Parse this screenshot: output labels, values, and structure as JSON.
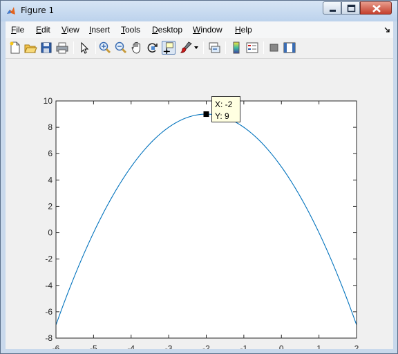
{
  "window": {
    "title": "Figure 1"
  },
  "menu": [
    {
      "label": "File",
      "u": "F",
      "rest": "ile"
    },
    {
      "label": "Edit",
      "u": "E",
      "rest": "dit"
    },
    {
      "label": "View",
      "u": "V",
      "rest": "iew"
    },
    {
      "label": "Insert",
      "u": "I",
      "rest": "nsert"
    },
    {
      "label": "Tools",
      "u": "T",
      "rest": "ools"
    },
    {
      "label": "Desktop",
      "u": "D",
      "rest": "esktop"
    },
    {
      "label": "Window",
      "u": "W",
      "rest": "indow"
    },
    {
      "label": "Help",
      "u": "H",
      "rest": "elp"
    }
  ],
  "toolbar": {
    "icons": [
      "new-figure-icon",
      "open-file-icon",
      "save-icon",
      "print-icon",
      "edit-plot-arrow-icon",
      "zoom-in-icon",
      "zoom-out-icon",
      "pan-hand-icon",
      "rotate-3d-icon",
      "data-cursor-icon",
      "brush-icon",
      "link-plot-icon",
      "insert-colorbar-icon",
      "insert-legend-icon",
      "hide-plot-tools-icon",
      "show-plot-tools-icon"
    ],
    "active": "data-cursor-icon"
  },
  "datatip": {
    "x_text": "X: -2",
    "y_text": "Y: 9"
  },
  "chart_data": {
    "type": "line",
    "title": "",
    "xlabel": "",
    "ylabel": "",
    "xlim": [
      -6,
      2
    ],
    "ylim": [
      -8,
      10
    ],
    "x_ticks": [
      -6,
      -5,
      -4,
      -3,
      -2,
      -1,
      0,
      1,
      2
    ],
    "y_ticks": [
      -8,
      -6,
      -4,
      -2,
      0,
      2,
      4,
      6,
      8,
      10
    ],
    "series": [
      {
        "function": "y = -(x + 2)^2 + 9",
        "x": [
          -6,
          -5,
          -4,
          -3,
          -2,
          -1,
          0,
          1,
          2
        ],
        "y": [
          -7,
          0,
          5,
          8,
          9,
          8,
          5,
          0,
          -7
        ],
        "color": "#0072bd"
      }
    ],
    "marker": {
      "x": -2,
      "y": 9
    },
    "grid": false
  }
}
